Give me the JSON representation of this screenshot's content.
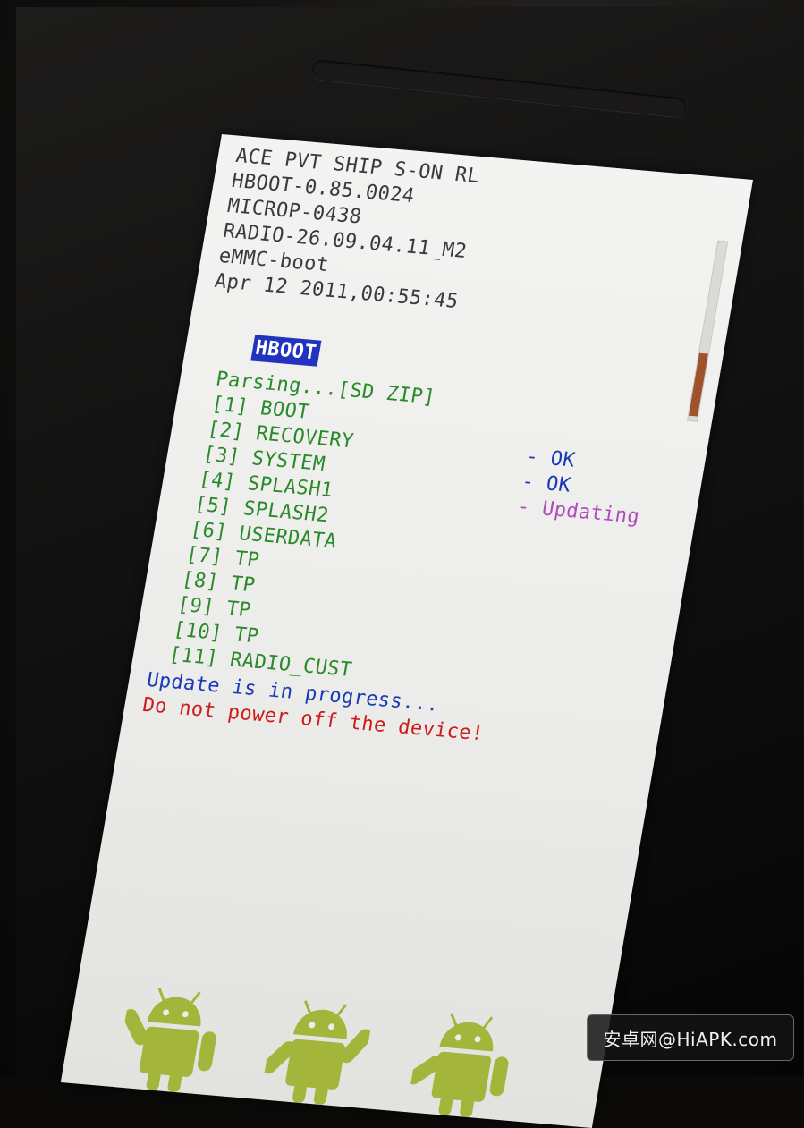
{
  "header": {
    "lines": [
      "ACE PVT SHIP S-ON RL",
      "HBOOT-0.85.0024",
      "MICROP-0438",
      "RADIO-26.09.04.11_M2",
      "eMMC-boot",
      "Apr 12 2011,00:55:45"
    ],
    "mode_label": "HBOOT"
  },
  "parsing": {
    "title": "Parsing...[SD ZIP]",
    "items": [
      "[1] BOOT",
      "[2] RECOVERY",
      "[3] SYSTEM",
      "[4] SPLASH1",
      "[5] SPLASH2",
      "[6] USERDATA",
      "[7] TP",
      "[8] TP",
      "[9] TP",
      "[10] TP",
      "[11] RADIO_CUST"
    ],
    "statuses": [
      "- OK",
      "- OK",
      "- Updating"
    ]
  },
  "messages": {
    "progress": "Update is in progress...",
    "warning": "Do not power off the device!"
  },
  "watermark": "安卓网@HiAPK.com",
  "colors": {
    "header_text": "#3a3a3a",
    "item_text": "#2a8a2a",
    "status_ok": "#1a39b8",
    "status_updating": "#b04ab8",
    "warning": "#d01a1a",
    "highlight": "#2233c0",
    "android_green": "#a4b53c"
  },
  "icons": [
    "android-robot-icon",
    "android-robot-icon",
    "android-robot-icon"
  ]
}
